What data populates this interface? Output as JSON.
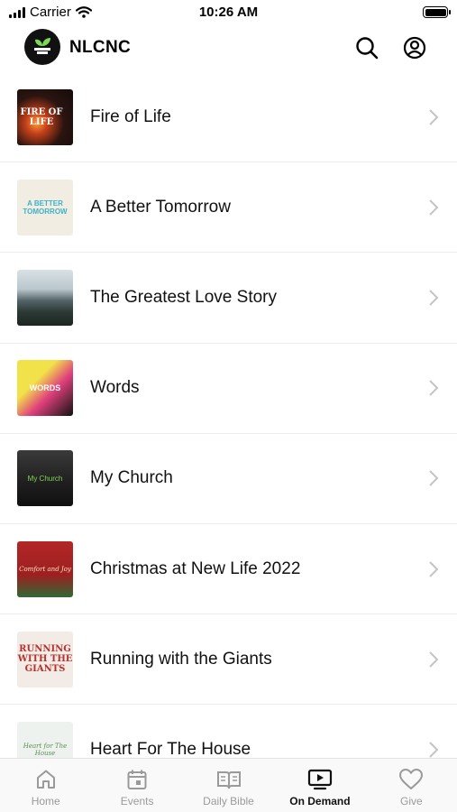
{
  "status_bar": {
    "carrier": "Carrier",
    "time": "10:26 AM"
  },
  "header": {
    "title": "NLCNC"
  },
  "items": [
    {
      "title": "Fire of Life",
      "thumb_text": "FIRE OF LIFE",
      "thumb_class": "t-fire"
    },
    {
      "title": "A Better Tomorrow",
      "thumb_text": "A BETTER TOMORROW",
      "thumb_class": "t-better"
    },
    {
      "title": "The Greatest Love Story",
      "thumb_text": "",
      "thumb_class": "t-love"
    },
    {
      "title": "Words",
      "thumb_text": "WORDS",
      "thumb_class": "t-words"
    },
    {
      "title": "My Church",
      "thumb_text": "My Church",
      "thumb_class": "t-church"
    },
    {
      "title": "Christmas at New Life 2022",
      "thumb_text": "Comfort and Joy",
      "thumb_class": "t-xmas"
    },
    {
      "title": "Running with the Giants",
      "thumb_text": "RUNNING WITH THE GIANTS",
      "thumb_class": "t-giants"
    },
    {
      "title": "Heart For The House",
      "thumb_text": "Heart for The House",
      "thumb_class": "t-heart"
    }
  ],
  "tabs": [
    {
      "label": "Home",
      "icon": "home-icon",
      "active": false
    },
    {
      "label": "Events",
      "icon": "calendar-icon",
      "active": false
    },
    {
      "label": "Daily Bible",
      "icon": "book-icon",
      "active": false
    },
    {
      "label": "On Demand",
      "icon": "play-tv-icon",
      "active": true
    },
    {
      "label": "Give",
      "icon": "heart-icon",
      "active": false
    }
  ]
}
